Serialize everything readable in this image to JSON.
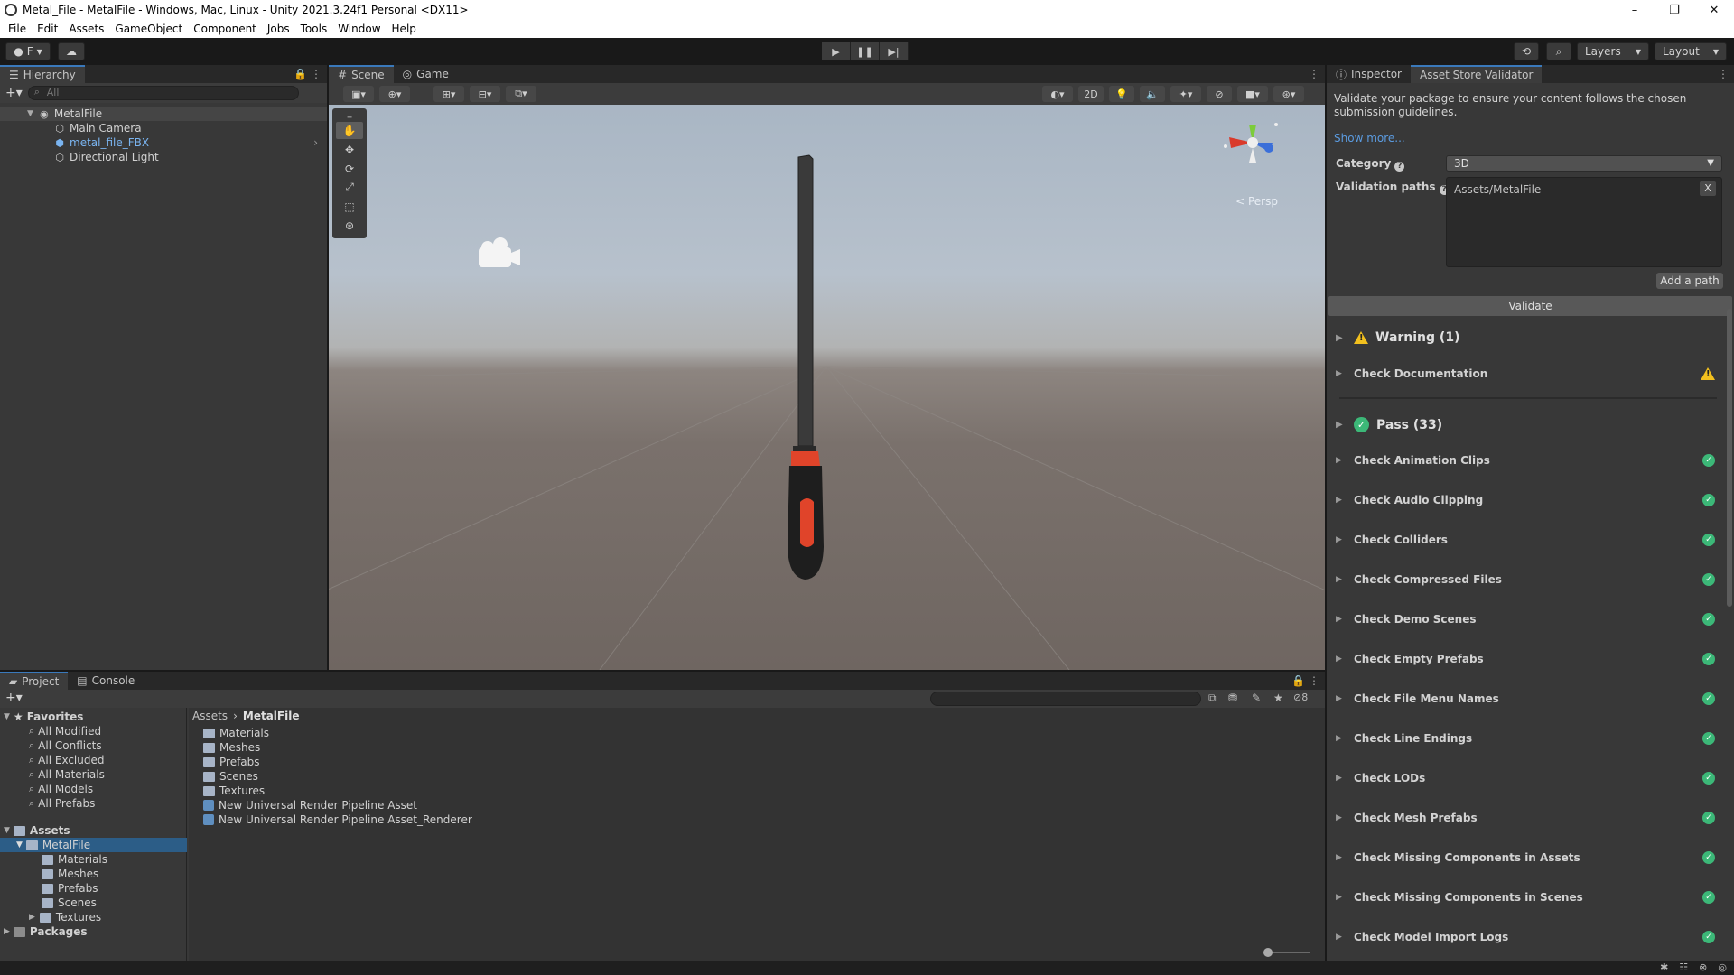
{
  "window": {
    "title": "Metal_File - MetalFile - Windows, Mac, Linux - Unity 2021.3.24f1 Personal <DX11>",
    "controls": [
      "–",
      "❐",
      "✕"
    ]
  },
  "menu": [
    "File",
    "Edit",
    "Assets",
    "GameObject",
    "Component",
    "Jobs",
    "Tools",
    "Window",
    "Help"
  ],
  "toolbar": {
    "account_label": "F",
    "layers_label": "Layers",
    "layout_label": "Layout"
  },
  "hierarchy": {
    "tab_label": "Hierarchy",
    "search_placeholder": "All",
    "scene_name": "MetalFile",
    "items": [
      {
        "label": "Main Camera",
        "icon": "gameobject-icon"
      },
      {
        "label": "metal_file_FBX",
        "icon": "prefab-icon"
      },
      {
        "label": "Directional Light",
        "icon": "gameobject-icon"
      }
    ]
  },
  "scene": {
    "tabs": [
      "Scene",
      "Game"
    ],
    "toggle_2d": "2D",
    "persp_label": "< Persp"
  },
  "inspector": {
    "tabs": [
      "Inspector",
      "Asset Store Validator"
    ],
    "description": "Validate your package to ensure your content follows the chosen submission guidelines.",
    "show_more": "Show more...",
    "category_label": "Category",
    "category_value": "3D",
    "validation_paths_label": "Validation paths",
    "path_value": "Assets/MetalFile",
    "remove_path": "X",
    "add_path_label": "Add a path",
    "validate_label": "Validate",
    "warning_header": "Warning (1)",
    "warning_items": [
      "Check Documentation"
    ],
    "pass_header": "Pass (33)",
    "pass_items": [
      "Check Animation Clips",
      "Check Audio Clipping",
      "Check Colliders",
      "Check Compressed Files",
      "Check Demo Scenes",
      "Check Empty Prefabs",
      "Check File Menu Names",
      "Check Line Endings",
      "Check LODs",
      "Check Mesh Prefabs",
      "Check Missing Components in Assets",
      "Check Missing Components in Scenes",
      "Check Model Import Logs"
    ],
    "colors": {
      "pass": "#3cb878",
      "warning": "#f2c01e"
    }
  },
  "project": {
    "tabs": [
      "Project",
      "Console"
    ],
    "hidden_count": "8",
    "favorites_label": "Favorites",
    "favorites": [
      "All Modified",
      "All Conflicts",
      "All Excluded",
      "All Materials",
      "All Models",
      "All Prefabs"
    ],
    "assets_label": "Assets",
    "metalfile_label": "MetalFile",
    "metalfile_children": [
      "Materials",
      "Meshes",
      "Prefabs",
      "Scenes",
      "Textures"
    ],
    "packages_label": "Packages",
    "breadcrumb": [
      "Assets",
      "MetalFile"
    ],
    "contents": [
      {
        "label": "Materials",
        "type": "folder"
      },
      {
        "label": "Meshes",
        "type": "folder"
      },
      {
        "label": "Prefabs",
        "type": "folder"
      },
      {
        "label": "Scenes",
        "type": "folder"
      },
      {
        "label": "Textures",
        "type": "folder"
      },
      {
        "label": "New Universal Render Pipeline Asset",
        "type": "asset"
      },
      {
        "label": "New Universal Render Pipeline Asset_Renderer",
        "type": "asset"
      }
    ]
  }
}
